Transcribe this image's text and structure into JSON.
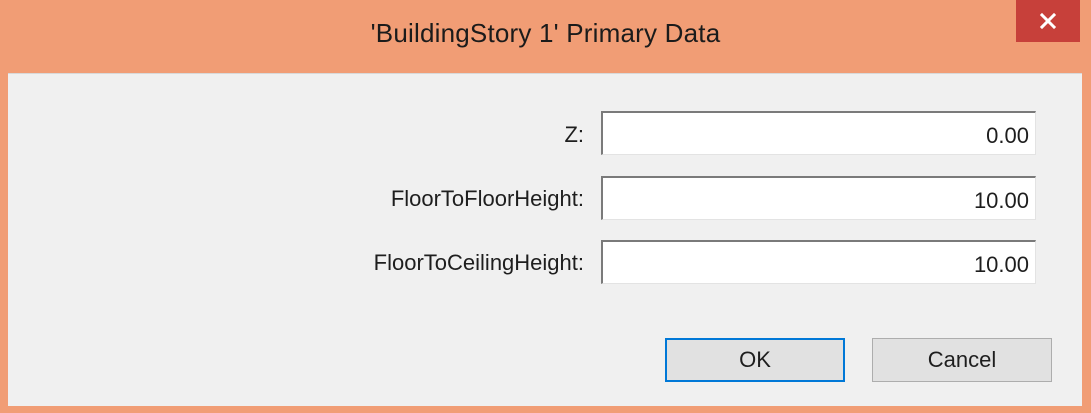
{
  "window": {
    "title": "'BuildingStory 1' Primary Data",
    "close_icon": "close-icon",
    "colors": {
      "titlebar": "#f19d75",
      "close_button": "#c7403a",
      "client": "#f0f0f0"
    }
  },
  "fields": {
    "z": {
      "label": "Z:",
      "value": "0.00"
    },
    "floor_to_floor": {
      "label": "FloorToFloorHeight:",
      "value": "10.00"
    },
    "floor_to_ceiling": {
      "label": "FloorToCeilingHeight:",
      "value": "10.00"
    }
  },
  "buttons": {
    "ok_label": "OK",
    "cancel_label": "Cancel"
  }
}
